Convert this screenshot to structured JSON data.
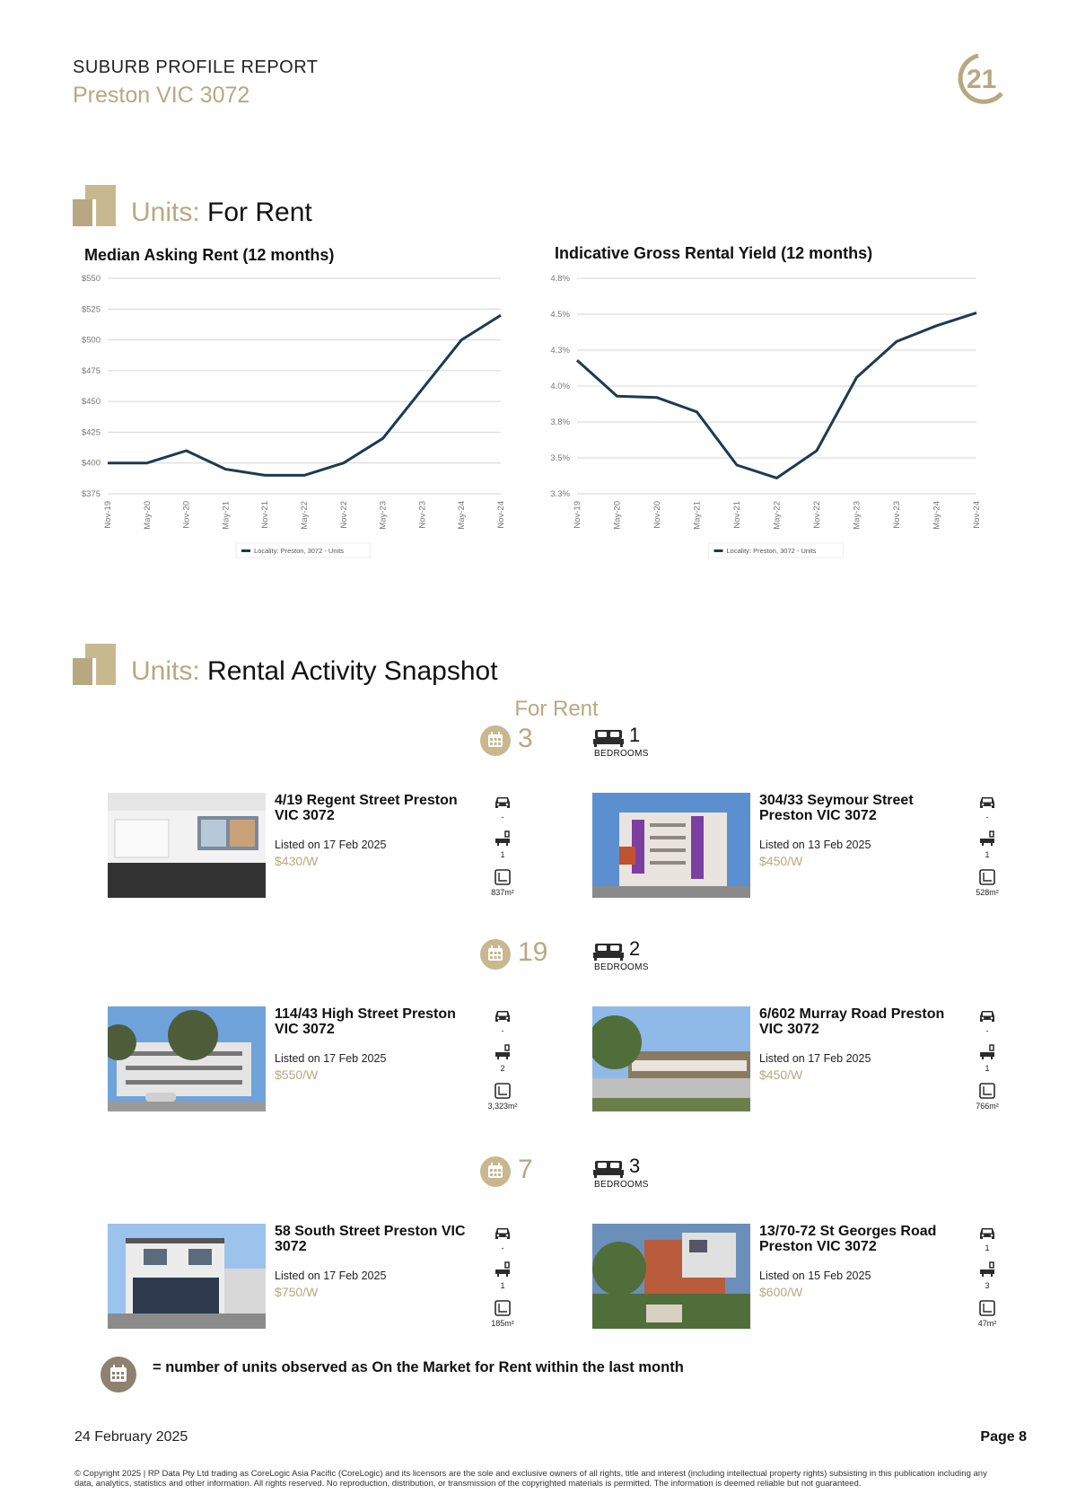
{
  "header": {
    "report_title": "SUBURB PROFILE REPORT",
    "suburb": "Preston VIC 3072",
    "logo_text": "21"
  },
  "section_rent": {
    "prefix": "Units:",
    "title": "For Rent"
  },
  "charts": {
    "legend_label": "Locality: Preston, 3072 - Units"
  },
  "chart_data": [
    {
      "type": "line",
      "title": "Median Asking Rent (12 months)",
      "xlabel": "",
      "ylabel": "",
      "categories": [
        "Nov-19",
        "May-20",
        "Nov-20",
        "May-21",
        "Nov-21",
        "May-22",
        "Nov-22",
        "May-23",
        "Nov-23",
        "May-24",
        "Nov-24"
      ],
      "y_ticks": [
        "$550",
        "$525",
        "$500",
        "$475",
        "$450",
        "$425",
        "$400",
        "$375"
      ],
      "ylim": [
        375,
        550
      ],
      "x": [
        0,
        1,
        1.5,
        2,
        3,
        4,
        5,
        6,
        7,
        8,
        9,
        10
      ],
      "series": [
        {
          "name": "Locality: Preston, 3072 - Units",
          "values": [
            400,
            400,
            410,
            395,
            390,
            390,
            400,
            420,
            460,
            500,
            520
          ],
          "x": [
            0,
            1,
            2,
            3,
            4,
            5,
            6,
            7,
            8,
            9,
            10
          ]
        }
      ],
      "grid": true,
      "legend_position": "bottom"
    },
    {
      "type": "line",
      "title": "Indicative Gross Rental Yield (12 months)",
      "xlabel": "",
      "ylabel": "",
      "categories": [
        "Nov-19",
        "May-20",
        "Nov-20",
        "May-21",
        "Nov-21",
        "May-22",
        "Nov-22",
        "May-23",
        "Nov-23",
        "May-24",
        "Nov-24"
      ],
      "y_ticks": [
        "4.8%",
        "4.5%",
        "4.3%",
        "4.0%",
        "3.8%",
        "3.5%",
        "3.3%"
      ],
      "ylim": [
        3.3,
        4.8
      ],
      "series": [
        {
          "name": "Locality: Preston, 3072 - Units",
          "values": [
            4.23,
            3.98,
            3.97,
            3.87,
            3.5,
            3.41,
            3.6,
            4.11,
            4.36,
            4.47,
            4.56
          ],
          "x": [
            0,
            1,
            2,
            3,
            4,
            5,
            6,
            7,
            8,
            9,
            10
          ]
        }
      ],
      "grid": true,
      "legend_position": "bottom"
    }
  ],
  "section_snapshot": {
    "prefix": "Units:",
    "title": "Rental Activity Snapshot",
    "for_rent_label": "For Rent",
    "bedrooms_label": "BEDROOMS"
  },
  "groups": [
    {
      "count": "3",
      "bedrooms": "1",
      "listings": [
        {
          "address": "4/19 Regent Street Preston VIC 3072",
          "listed": "Listed on 17 Feb 2025",
          "price": "$430/W",
          "car": "-",
          "bath": "1",
          "area": "837m²",
          "photo": "interior"
        },
        {
          "address": "304/33 Seymour Street Preston VIC 3072",
          "listed": "Listed on 13 Feb 2025",
          "price": "$450/W",
          "car": "-",
          "bath": "1",
          "area": "528m²",
          "photo": "building"
        }
      ]
    },
    {
      "count": "19",
      "bedrooms": "2",
      "listings": [
        {
          "address": "114/43 High Street Preston VIC 3072",
          "listed": "Listed on 17 Feb 2025",
          "price": "$550/W",
          "car": "-",
          "bath": "2",
          "area": "3,323m²",
          "photo": "street"
        },
        {
          "address": "6/602 Murray Road Preston VIC 3072",
          "listed": "Listed on 17 Feb 2025",
          "price": "$450/W",
          "car": "-",
          "bath": "1",
          "area": "766m²",
          "photo": "garden"
        }
      ]
    },
    {
      "count": "7",
      "bedrooms": "3",
      "listings": [
        {
          "address": "58 South Street Preston VIC 3072",
          "listed": "Listed on 17 Feb 2025",
          "price": "$750/W",
          "car": "-",
          "bath": "1",
          "area": "185m²",
          "photo": "townhouse"
        },
        {
          "address": "13/70-72 St Georges Road Preston VIC 3072",
          "listed": "Listed on 15 Feb 2025",
          "price": "$600/W",
          "car": "1",
          "bath": "3",
          "area": "47m²",
          "photo": "modern"
        }
      ]
    }
  ],
  "legend_note": "= number of units observed as On the Market for Rent within the last month",
  "footer": {
    "date": "24 February  2025",
    "page": "Page 8",
    "copyright": "© Copyright 2025 | RP Data Pty Ltd trading as CoreLogic Asia Pacific (CoreLogic) and its licensors are the sole and exclusive owners of all rights, title and interest (including intellectual property rights) subsisting in this publication including any data, analytics, statistics and other information. All rights reserved. No reproduction, distribution, or transmission of the copyrighted materials is permitted. The information is deemed reliable but not guaranteed."
  },
  "colors": {
    "gold": "#b8a882",
    "navy": "#1c3a52",
    "grid": "#d6d6d6"
  }
}
